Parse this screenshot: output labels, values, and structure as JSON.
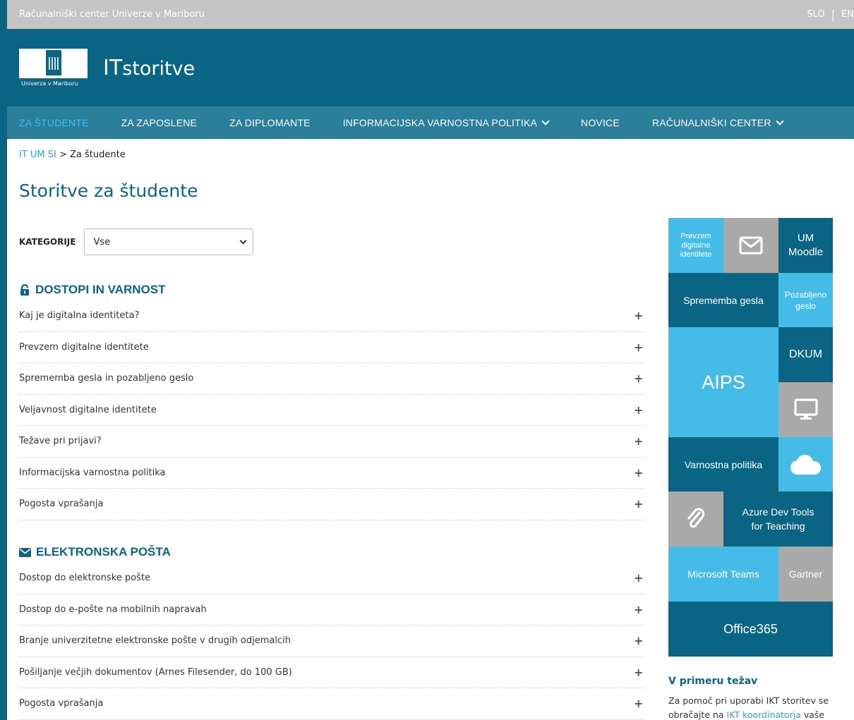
{
  "topbar": {
    "title": "Računalniški center Univerze v Mariboru",
    "lang_slo": "SLO",
    "lang_eng": "ENG"
  },
  "header": {
    "logo_text": "Univerza v Mariboru",
    "brand_it": "IT",
    "brand_rest": "storitve"
  },
  "nav": {
    "items": [
      {
        "label": "ZA ŠTUDENTE"
      },
      {
        "label": "ZA ZAPOSLENE"
      },
      {
        "label": "ZA DIPLOMANTE"
      },
      {
        "label": "INFORMACIJSKA VARNOSTNA POLITIKA"
      },
      {
        "label": "NOVICE"
      },
      {
        "label": "RAČUNALNIŠKI CENTER"
      }
    ]
  },
  "breadcrumb": {
    "home": "IT UM SI",
    "sep": " > ",
    "current": "Za študente"
  },
  "page_title": "Storitve za študente",
  "category": {
    "label": "KATEGORIJE",
    "value": "Vse"
  },
  "sections": [
    {
      "title": "DOSTOPI IN VARNOST",
      "icon": "lock-icon",
      "items": [
        "Kaj je digitalna identiteta?",
        "Prevzem digitalne identitete",
        "Sprememba gesla in pozabljeno geslo",
        "Veljavnost digitalne identitete",
        "Težave pri prijavi?",
        "Informacijska varnostna politika",
        "Pogosta vprašanja"
      ]
    },
    {
      "title": "ELEKTRONSKA POŠTA",
      "icon": "envelope-icon",
      "items": [
        "Dostop do elektronske pošte",
        "Dostop do e-pošte na mobilnih napravah",
        "Branje univerzitetne elektronske pošte v drugih odjemalcih",
        "Pošiljanje večjih dokumentov (Arnes Filesender, do 100 GB)",
        "Pogosta vprašanja"
      ]
    }
  ],
  "tiles": {
    "prevzem": "Prevzem digitalne identitete",
    "moodle": "UM Moodle",
    "sprememba": "Sprememba gesla",
    "pozabljeno": "Pozabljeno geslo",
    "aips": "AIPS",
    "dkum": "DKUM",
    "varnostna": "Varnostna politika",
    "azure": "Azure Dev Tools for Teaching",
    "teams": "Microsoft Teams",
    "gartner": "Gartner",
    "office": "Office365"
  },
  "help": {
    "title": "V primeru težav",
    "text1": "Za pomoč pri uporabi IKT storitev se obračajte na ",
    "link": "IKT koordinatorja",
    "text2": " vaše"
  },
  "colors": {
    "dark": "#0a6585",
    "light": "#45bce8",
    "gray": "#a9a9a9",
    "accent": "#3fc1ea"
  }
}
